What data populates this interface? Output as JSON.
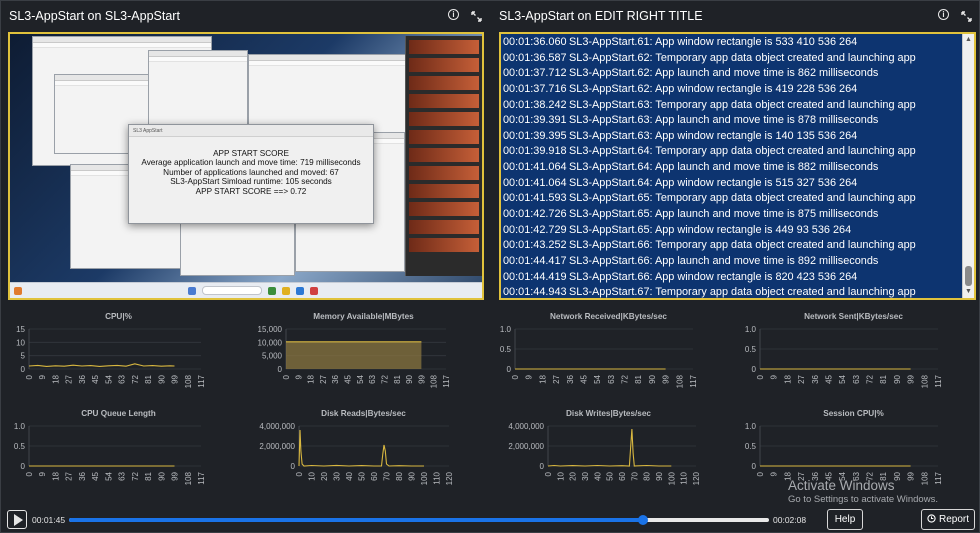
{
  "left_panel": {
    "title": "SL3-AppStart on SL3-AppStart",
    "info_icon": "info-circle-icon",
    "expand_icon": "expand-arrows-icon"
  },
  "right_panel": {
    "title": "SL3-AppStart on EDIT RIGHT TITLE",
    "info_icon": "info-circle-icon",
    "expand_icon": "expand-arrows-icon"
  },
  "score_dialog": {
    "caption": "SL3 AppStart",
    "lines": [
      "APP START SCORE",
      "Average application launch and move time: 719 milliseconds",
      "Number of applications launched and moved: 67",
      "SL3-AppStart Simload runtime: 105 seconds",
      "APP START SCORE ==> 0.72"
    ]
  },
  "log_lines": [
    {
      "ts": "00:01:36.060",
      "msg": "SL3-AppStart.61: App window rectangle is 533 410 536 264"
    },
    {
      "ts": "00:01:36.587",
      "msg": "SL3-AppStart.62: Temporary app data object created and launching app"
    },
    {
      "ts": "00:01:37.712",
      "msg": "SL3-AppStart.62: App launch and move time is 862 milliseconds"
    },
    {
      "ts": "00:01:37.716",
      "msg": "SL3-AppStart.62: App window rectangle is 419 228 536 264"
    },
    {
      "ts": "00:01:38.242",
      "msg": "SL3-AppStart.63: Temporary app data object created and launching app"
    },
    {
      "ts": "00:01:39.391",
      "msg": "SL3-AppStart.63: App launch and move time is 878 milliseconds"
    },
    {
      "ts": "00:01:39.395",
      "msg": "SL3-AppStart.63: App window rectangle is 140 135 536 264"
    },
    {
      "ts": "00:01:39.918",
      "msg": "SL3-AppStart.64: Temporary app data object created and launching app"
    },
    {
      "ts": "00:01:41.064",
      "msg": "SL3-AppStart.64: App launch and move time is 882 milliseconds"
    },
    {
      "ts": "00:01:41.064",
      "msg": "SL3-AppStart.64: App window rectangle is 515 327 536 264"
    },
    {
      "ts": "00:01:41.593",
      "msg": "SL3-AppStart.65: Temporary app data object created and launching app"
    },
    {
      "ts": "00:01:42.726",
      "msg": "SL3-AppStart.65: App launch and move time is 875 milliseconds"
    },
    {
      "ts": "00:01:42.729",
      "msg": "SL3-AppStart.65: App window rectangle is 449 93 536 264"
    },
    {
      "ts": "00:01:43.252",
      "msg": "SL3-AppStart.66: Temporary app data object created and launching app"
    },
    {
      "ts": "00:01:44.417",
      "msg": "SL3-AppStart.66: App launch and move time is 892 milliseconds"
    },
    {
      "ts": "00:01:44.419",
      "msg": "SL3-AppStart.66: App window rectangle is 820 423 536 264"
    },
    {
      "ts": "00:01:44.943",
      "msg": "SL3-AppStart.67: Temporary app data object created and launching app"
    }
  ],
  "chart_data": [
    {
      "id": "cpu",
      "type": "line",
      "title": "CPU|%",
      "y_ticks": [
        "15",
        "10",
        "5",
        "0"
      ],
      "ylim": [
        0,
        20
      ],
      "x_ticks": [
        "0",
        "9",
        "18",
        "27",
        "36",
        "45",
        "54",
        "63",
        "72",
        "81",
        "90",
        "99",
        "108",
        "117"
      ],
      "xlim": [
        0,
        117
      ],
      "color": "#d9b840",
      "fill": false,
      "x": [
        0,
        6,
        12,
        18,
        24,
        30,
        36,
        42,
        48,
        54,
        60,
        66,
        72,
        78,
        84,
        90,
        96,
        99
      ],
      "y": [
        1.5,
        1.8,
        1.3,
        1.6,
        1.4,
        1.9,
        1.5,
        1.7,
        1.3,
        1.6,
        1.8,
        1.4,
        2.6,
        1.5,
        1.7,
        1.4,
        1.6,
        1.5
      ]
    },
    {
      "id": "memory",
      "type": "area",
      "title": "Memory Available|MBytes",
      "y_ticks": [
        "15,000",
        "10,000",
        "5,000",
        "0"
      ],
      "ylim": [
        0,
        15000
      ],
      "x_ticks": [
        "0",
        "9",
        "18",
        "27",
        "36",
        "45",
        "54",
        "63",
        "72",
        "81",
        "90",
        "99",
        "108",
        "117"
      ],
      "xlim": [
        0,
        117
      ],
      "color": "#d9b840",
      "fill": true,
      "x": [
        0,
        99
      ],
      "y": [
        10200,
        10200
      ]
    },
    {
      "id": "net_recv",
      "type": "line",
      "title": "Network Received|KBytes/sec",
      "y_ticks": [
        "1.0",
        "0.5",
        "0"
      ],
      "ylim": [
        0,
        1
      ],
      "x_ticks": [
        "0",
        "9",
        "18",
        "27",
        "36",
        "45",
        "54",
        "63",
        "72",
        "81",
        "90",
        "99",
        "108",
        "117"
      ],
      "xlim": [
        0,
        117
      ],
      "color": "#d9b840",
      "fill": false,
      "x": [
        0,
        99
      ],
      "y": [
        0,
        0
      ]
    },
    {
      "id": "net_sent",
      "type": "line",
      "title": "Network Sent|KBytes/sec",
      "y_ticks": [
        "1.0",
        "0.5",
        "0"
      ],
      "ylim": [
        0,
        1
      ],
      "x_ticks": [
        "0",
        "9",
        "18",
        "27",
        "36",
        "45",
        "54",
        "63",
        "72",
        "81",
        "90",
        "99",
        "108",
        "117"
      ],
      "xlim": [
        0,
        117
      ],
      "color": "#d9b840",
      "fill": false,
      "x": [
        0,
        99
      ],
      "y": [
        0,
        0
      ]
    },
    {
      "id": "cpu_queue",
      "type": "line",
      "title": "CPU Queue Length",
      "y_ticks": [
        "1.0",
        "0.5",
        "0"
      ],
      "ylim": [
        0,
        1
      ],
      "x_ticks": [
        "0",
        "9",
        "18",
        "27",
        "36",
        "45",
        "54",
        "63",
        "72",
        "81",
        "90",
        "99",
        "108",
        "117"
      ],
      "xlim": [
        0,
        117
      ],
      "color": "#d9b840",
      "fill": false,
      "x": [
        0,
        99
      ],
      "y": [
        0,
        0
      ]
    },
    {
      "id": "disk_reads",
      "type": "line",
      "title": "Disk Reads|Bytes/sec",
      "y_ticks": [
        "4,000,000",
        "2,000,000",
        "0"
      ],
      "ylim": [
        0,
        4000000
      ],
      "x_ticks": [
        "0",
        "10",
        "20",
        "30",
        "40",
        "50",
        "60",
        "70",
        "80",
        "90",
        "100",
        "110",
        "120"
      ],
      "xlim": [
        0,
        120
      ],
      "color": "#d9b840",
      "fill": false,
      "x": [
        0,
        0.8,
        1.5,
        2.5,
        4,
        10,
        20,
        30,
        40,
        50,
        60,
        66,
        67,
        68,
        69,
        70,
        72,
        80,
        90,
        100
      ],
      "y": [
        0,
        3600000,
        1500000,
        200000,
        0,
        50000,
        0,
        60000,
        0,
        40000,
        0,
        0,
        1200000,
        2100000,
        1500000,
        200000,
        0,
        30000,
        0,
        0
      ]
    },
    {
      "id": "disk_writes",
      "type": "line",
      "title": "Disk Writes|Bytes/sec",
      "y_ticks": [
        "4,000,000",
        "2,000,000",
        "0"
      ],
      "ylim": [
        0,
        4000000
      ],
      "x_ticks": [
        "0",
        "10",
        "20",
        "30",
        "40",
        "50",
        "60",
        "70",
        "80",
        "90",
        "100",
        "110",
        "120"
      ],
      "xlim": [
        0,
        120
      ],
      "color": "#d9b840",
      "fill": false,
      "x": [
        0,
        5,
        10,
        20,
        30,
        40,
        50,
        60,
        66,
        67,
        68,
        69,
        70,
        80,
        90,
        100
      ],
      "y": [
        0,
        50000,
        0,
        40000,
        0,
        50000,
        0,
        30000,
        0,
        1800000,
        3700000,
        1300000,
        0,
        50000,
        0,
        0
      ]
    },
    {
      "id": "session_cpu",
      "type": "line",
      "title": "Session CPU|%",
      "y_ticks": [
        "1.0",
        "0.5",
        "0"
      ],
      "ylim": [
        0,
        1
      ],
      "x_ticks": [
        "0",
        "9",
        "18",
        "27",
        "36",
        "45",
        "54",
        "63",
        "72",
        "81",
        "90",
        "99",
        "108",
        "117"
      ],
      "xlim": [
        0,
        117
      ],
      "color": "#d9b840",
      "fill": false,
      "x": [
        0,
        99
      ],
      "y": [
        0,
        0
      ]
    }
  ],
  "playback": {
    "current_time": "00:01:45",
    "total_time": "00:02:08",
    "progress": 0.82
  },
  "buttons": {
    "help_label": "Help",
    "report_label": "Report",
    "report_icon": "clock-icon"
  },
  "watermark": {
    "line1": "Activate Windows",
    "line2": "Go to Settings to activate Windows."
  }
}
